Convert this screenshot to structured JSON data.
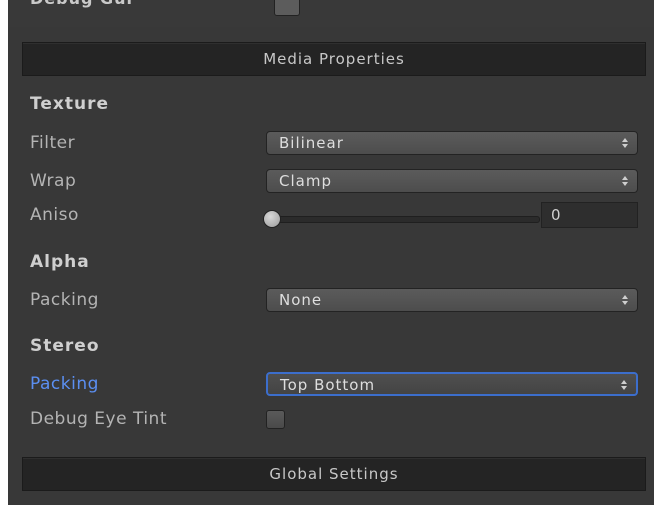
{
  "top_cut": {
    "label": "Debug Gui"
  },
  "media_header": {
    "label": "Media Properties"
  },
  "texture": {
    "title": "Texture",
    "filter": {
      "label": "Filter",
      "value": "Bilinear"
    },
    "wrap": {
      "label": "Wrap",
      "value": "Clamp"
    },
    "aniso": {
      "label": "Aniso",
      "value": "0",
      "level": 0
    }
  },
  "alpha": {
    "title": "Alpha",
    "packing": {
      "label": "Packing",
      "value": "None"
    }
  },
  "stereo": {
    "title": "Stereo",
    "packing": {
      "label": "Packing",
      "value": "Top Bottom"
    },
    "debug_eye_tint": {
      "label": "Debug Eye Tint",
      "checked": false
    }
  },
  "global_header": {
    "label": "Global Settings"
  },
  "colors": {
    "panel_bg": "#383838",
    "header_bg": "#242424",
    "focus_accent": "#3c6ecc",
    "active_label": "#5b8ff2"
  }
}
